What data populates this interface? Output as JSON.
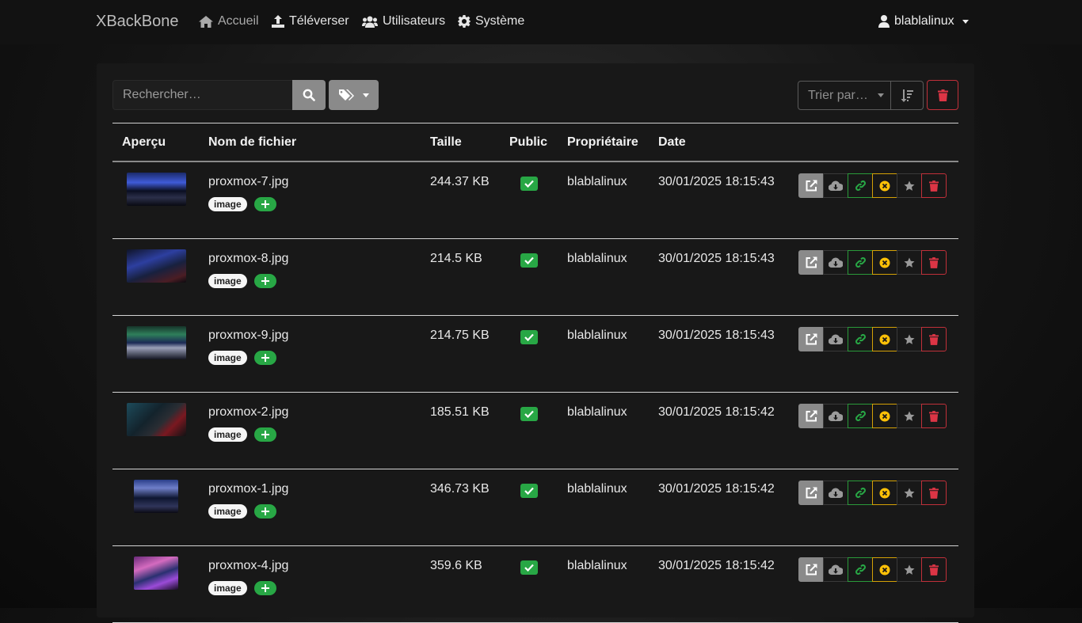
{
  "navbar": {
    "brand": "XBackBone",
    "links": [
      {
        "label": "Accueil",
        "icon": "home-icon"
      },
      {
        "label": "Téléverser",
        "icon": "upload-icon"
      },
      {
        "label": "Utilisateurs",
        "icon": "users-icon"
      },
      {
        "label": "Système",
        "icon": "gear-icon"
      }
    ],
    "user": "blablalinux"
  },
  "toolbar": {
    "search_placeholder": "Rechercher…",
    "sort_label": "Trier par…"
  },
  "table": {
    "headers": [
      "Aperçu",
      "Nom de fichier",
      "Taille",
      "Public",
      "Propriétaire",
      "Date"
    ],
    "rows": [
      {
        "filename": "proxmox-7.jpg",
        "tag": "image",
        "size": "244.37 KB",
        "public": true,
        "owner": "blablalinux",
        "date": "30/01/2025 18:15:43"
      },
      {
        "filename": "proxmox-8.jpg",
        "tag": "image",
        "size": "214.5 KB",
        "public": true,
        "owner": "blablalinux",
        "date": "30/01/2025 18:15:43"
      },
      {
        "filename": "proxmox-9.jpg",
        "tag": "image",
        "size": "214.75 KB",
        "public": true,
        "owner": "blablalinux",
        "date": "30/01/2025 18:15:43"
      },
      {
        "filename": "proxmox-2.jpg",
        "tag": "image",
        "size": "185.51 KB",
        "public": true,
        "owner": "blablalinux",
        "date": "30/01/2025 18:15:42"
      },
      {
        "filename": "proxmox-1.jpg",
        "tag": "image",
        "size": "346.73 KB",
        "public": true,
        "owner": "blablalinux",
        "date": "30/01/2025 18:15:42"
      },
      {
        "filename": "proxmox-4.jpg",
        "tag": "image",
        "size": "359.6 KB",
        "public": true,
        "owner": "blablalinux",
        "date": "30/01/2025 18:15:42"
      }
    ]
  },
  "colors": {
    "success": "#28a745",
    "danger": "#dc3545",
    "warning": "#ffc107",
    "secondary": "#8a8a8a"
  }
}
